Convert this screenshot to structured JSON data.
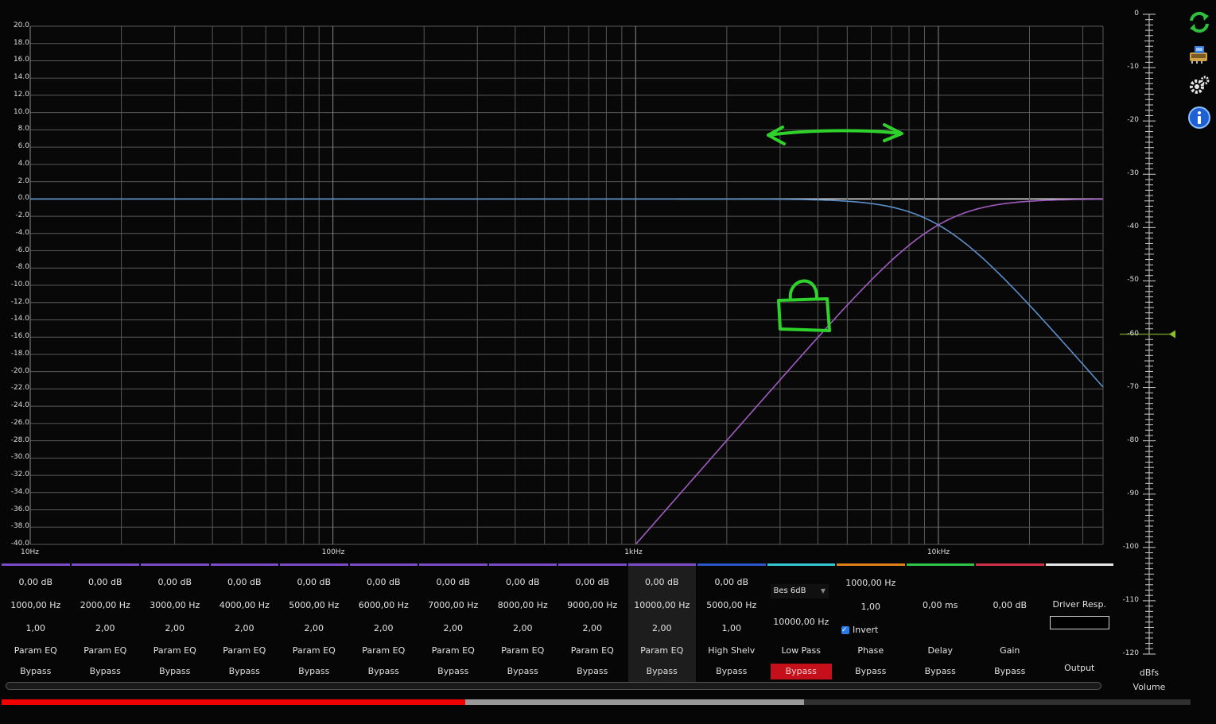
{
  "graph": {
    "y_labels": [
      "20.0",
      "18.0",
      "16.0",
      "14.0",
      "12.0",
      "10.0",
      "8.0",
      "6.0",
      "4.0",
      "2.0",
      "0.0",
      "-2.0",
      "-4.0",
      "-6.0",
      "-8.0",
      "-10.0",
      "-12.0",
      "-14.0",
      "-16.0",
      "-18.0",
      "-20.0",
      "-22.0",
      "-24.0",
      "-26.0",
      "-28.0",
      "-30.0",
      "-32.0",
      "-34.0",
      "-36.0",
      "-38.0",
      "-40.0"
    ],
    "x_labels": [
      "10Hz",
      "100Hz",
      "1kHz",
      "10kHz"
    ],
    "ylim": [
      -40,
      20
    ],
    "xlim_hz": [
      10,
      35000
    ],
    "lowpass_cutoff_hz": 10000,
    "highpass_cutoff_hz": 10000,
    "lowpass_color": "#5b8fc9",
    "highpass_color": "#a05cc0",
    "annotation_color": "#2fd12b"
  },
  "volume": {
    "labels": [
      "0",
      "-10",
      "-20",
      "-30",
      "-40",
      "-50",
      "-60",
      "-70",
      "-80",
      "-90",
      "-100",
      "-110",
      "-120"
    ],
    "level_db": -60,
    "unit": "dBfs",
    "title": "Volume"
  },
  "channels": [
    {
      "gain": "0,00 dB",
      "freq": "1000,00 Hz",
      "q": "1,00",
      "type": "Param EQ",
      "bypass": "Bypass",
      "color": "#7b4bc7"
    },
    {
      "gain": "0,00 dB",
      "freq": "2000,00 Hz",
      "q": "2,00",
      "type": "Param EQ",
      "bypass": "Bypass",
      "color": "#7b4bc7"
    },
    {
      "gain": "0,00 dB",
      "freq": "3000,00 Hz",
      "q": "2,00",
      "type": "Param EQ",
      "bypass": "Bypass",
      "color": "#7b4bc7"
    },
    {
      "gain": "0,00 dB",
      "freq": "4000,00 Hz",
      "q": "2,00",
      "type": "Param EQ",
      "bypass": "Bypass",
      "color": "#7b4bc7"
    },
    {
      "gain": "0,00 dB",
      "freq": "5000,00 Hz",
      "q": "2,00",
      "type": "Param EQ",
      "bypass": "Bypass",
      "color": "#7b4bc7"
    },
    {
      "gain": "0,00 dB",
      "freq": "6000,00 Hz",
      "q": "2,00",
      "type": "Param EQ",
      "bypass": "Bypass",
      "color": "#7b4bc7"
    },
    {
      "gain": "0,00 dB",
      "freq": "7000,00 Hz",
      "q": "2,00",
      "type": "Param EQ",
      "bypass": "Bypass",
      "color": "#7b4bc7"
    },
    {
      "gain": "0,00 dB",
      "freq": "8000,00 Hz",
      "q": "2,00",
      "type": "Param EQ",
      "bypass": "Bypass",
      "color": "#7b4bc7"
    },
    {
      "gain": "0,00 dB",
      "freq": "9000,00 Hz",
      "q": "2,00",
      "type": "Param EQ",
      "bypass": "Bypass",
      "color": "#7b4bc7"
    },
    {
      "gain": "0,00 dB",
      "freq": "10000,00 Hz",
      "q": "2,00",
      "type": "Param EQ",
      "bypass": "Bypass",
      "color": "#7b4bc7"
    },
    {
      "gain": "0,00 dB",
      "freq": "5000,00 Hz",
      "q": "1,00",
      "type": "High Shelv",
      "bypass": "Bypass",
      "color": "#2a57c9"
    }
  ],
  "lowpass": {
    "filter": "Bes 6dB",
    "freq": "10000,00 Hz",
    "type": "Low Pass",
    "bypass": "Bypass",
    "color": "#33c9d4"
  },
  "phase": {
    "freq": "1000,00 Hz",
    "q": "1,00",
    "invert_label": "Invert",
    "invert_checked": true,
    "type": "Phase",
    "bypass": "Bypass",
    "color": "#e0801c"
  },
  "delay": {
    "value": "0,00 ms",
    "type": "Delay",
    "bypass": "Bypass",
    "color": "#2fc449"
  },
  "gain": {
    "value": "0,00 dB",
    "type": "Gain",
    "bypass": "Bypass",
    "color": "#d0304a"
  },
  "output": {
    "label": "Driver Resp.",
    "title": "Output",
    "color": "#e8e8e8"
  },
  "playback": {
    "played": 0.39,
    "buffered": 0.675
  }
}
